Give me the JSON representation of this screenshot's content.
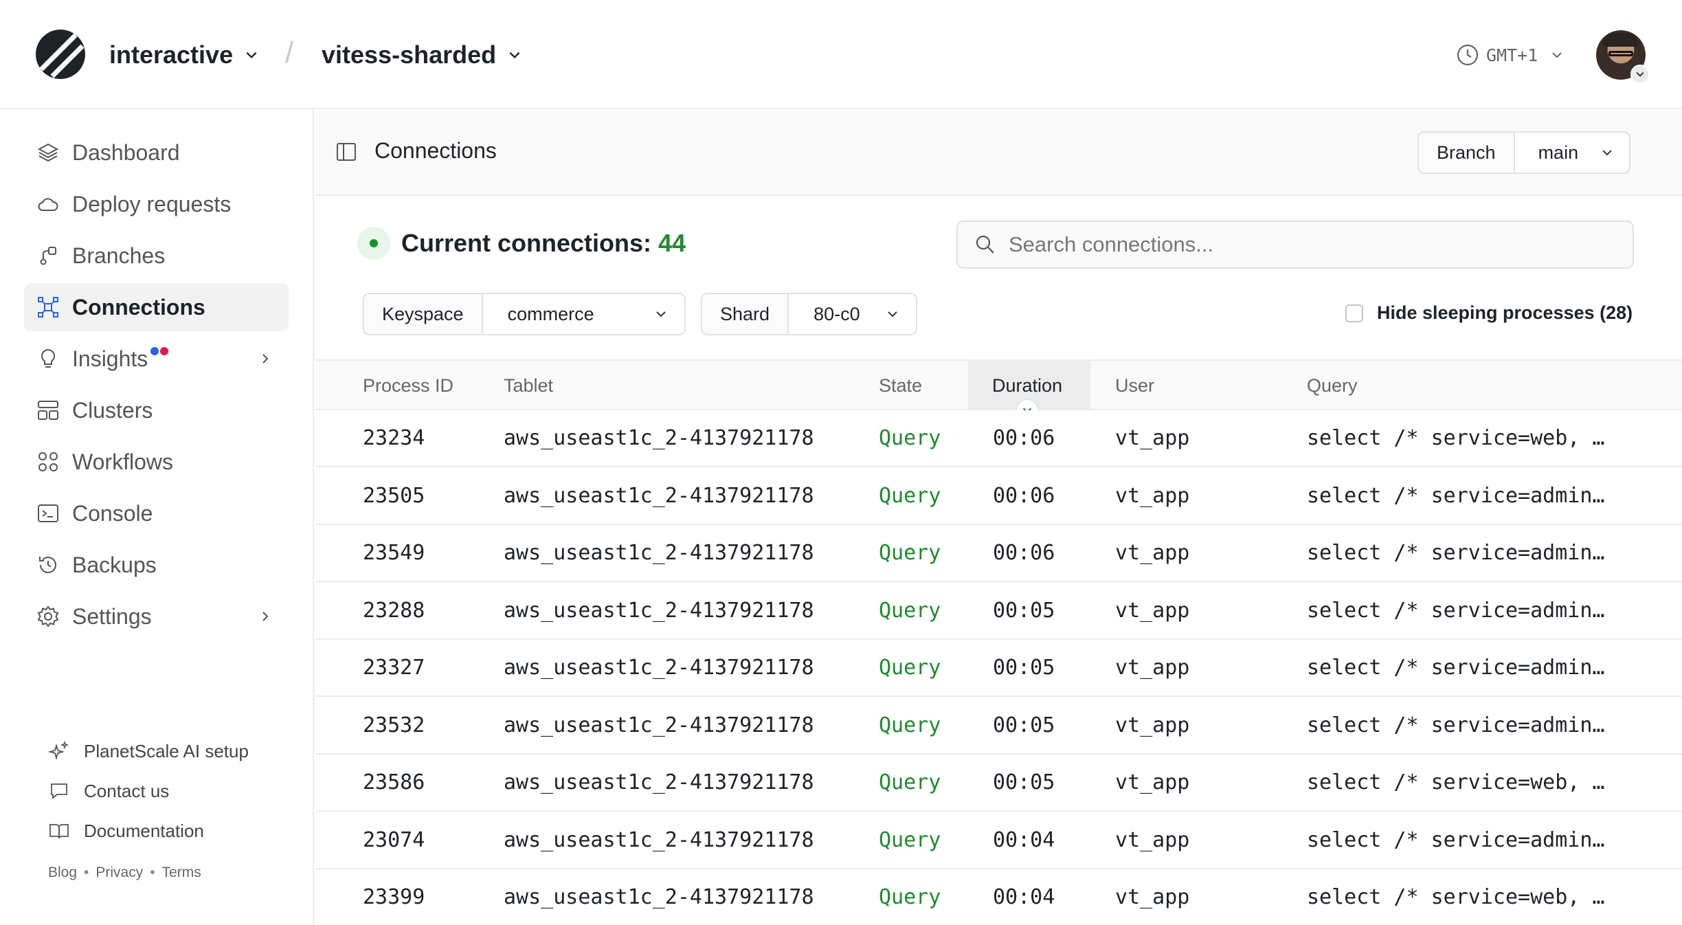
{
  "header": {
    "org": "interactive",
    "separator": "/",
    "database": "vitess-sharded",
    "timezone": "GMT+1"
  },
  "sidebar": {
    "items": [
      {
        "label": "Dashboard",
        "icon": "layers-icon"
      },
      {
        "label": "Deploy requests",
        "icon": "cloud-icon"
      },
      {
        "label": "Branches",
        "icon": "branch-icon"
      },
      {
        "label": "Connections",
        "icon": "connections-icon",
        "active": true
      },
      {
        "label": "Insights",
        "icon": "lightbulb-icon"
      },
      {
        "label": "Clusters",
        "icon": "clusters-icon"
      },
      {
        "label": "Workflows",
        "icon": "workflows-icon"
      },
      {
        "label": "Console",
        "icon": "terminal-icon"
      },
      {
        "label": "Backups",
        "icon": "history-icon"
      },
      {
        "label": "Settings",
        "icon": "gear-icon"
      }
    ],
    "footer": {
      "ai_setup": "PlanetScale AI setup",
      "contact": "Contact us",
      "docs": "Documentation",
      "blog": "Blog",
      "privacy": "Privacy",
      "terms": "Terms",
      "dot": "•"
    }
  },
  "main": {
    "title": "Connections",
    "branch_label": "Branch",
    "branch_value": "main",
    "status_label": "Current connections:",
    "status_count": "44",
    "search_placeholder": "Search connections...",
    "keyspace_label": "Keyspace",
    "keyspace_value": "commerce",
    "shard_label": "Shard",
    "shard_value": "80-c0",
    "hide_sleeping": "Hide sleeping processes (28)"
  },
  "table": {
    "columns": [
      "Process ID",
      "Tablet",
      "State",
      "Duration",
      "User",
      "Query"
    ],
    "sorted_column": "Duration",
    "rows": [
      [
        "23234",
        "aws_useast1c_2-4137921178",
        "Query",
        "00:06",
        "vt_app",
        "select /* service=web, …"
      ],
      [
        "23505",
        "aws_useast1c_2-4137921178",
        "Query",
        "00:06",
        "vt_app",
        "select /* service=admin…"
      ],
      [
        "23549",
        "aws_useast1c_2-4137921178",
        "Query",
        "00:06",
        "vt_app",
        "select /* service=admin…"
      ],
      [
        "23288",
        "aws_useast1c_2-4137921178",
        "Query",
        "00:05",
        "vt_app",
        "select /* service=admin…"
      ],
      [
        "23327",
        "aws_useast1c_2-4137921178",
        "Query",
        "00:05",
        "vt_app",
        "select /* service=admin…"
      ],
      [
        "23532",
        "aws_useast1c_2-4137921178",
        "Query",
        "00:05",
        "vt_app",
        "select /* service=admin…"
      ],
      [
        "23586",
        "aws_useast1c_2-4137921178",
        "Query",
        "00:05",
        "vt_app",
        "select /* service=web, …"
      ],
      [
        "23074",
        "aws_useast1c_2-4137921178",
        "Query",
        "00:04",
        "vt_app",
        "select /* service=admin…"
      ],
      [
        "23399",
        "aws_useast1c_2-4137921178",
        "Query",
        "00:04",
        "vt_app",
        "select /* service=web, …"
      ]
    ]
  },
  "colors": {
    "accent_green": "#1f8a2e",
    "active_bg": "#f2f2f2",
    "insights_dot_blue": "#2563eb",
    "insights_dot_red": "#e5193a"
  }
}
